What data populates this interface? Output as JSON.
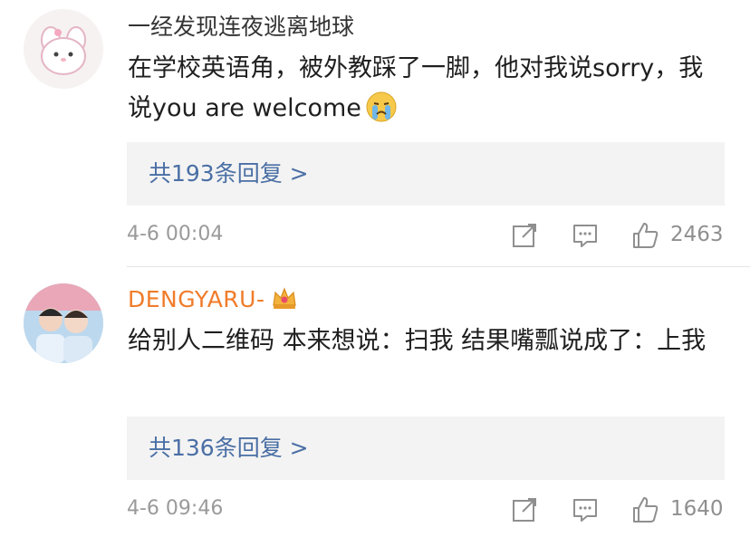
{
  "comments": [
    {
      "username": "一经发现连夜逃离地球",
      "text": "在学校英语角，被外教踩了一脚，他对我说sorry，我说you are welcome",
      "emoji": "crying-emoji",
      "replies_label": "共193条回复 >",
      "time": "4-6 00:04",
      "likes": "2463"
    },
    {
      "username": "DENGYARU-",
      "badge": "crown-icon",
      "text": "给别人二维码 本来想说：扫我 结果嘴瓢说成了：上我",
      "replies_label": "共136条回复 >",
      "time": "4-6 09:46",
      "likes": "1640"
    }
  ],
  "colors": {
    "username_vip": "#f07c2a",
    "reply_link": "#4a6fa5",
    "reply_bg": "#f3f3f3",
    "meta": "#9a9a9a"
  }
}
